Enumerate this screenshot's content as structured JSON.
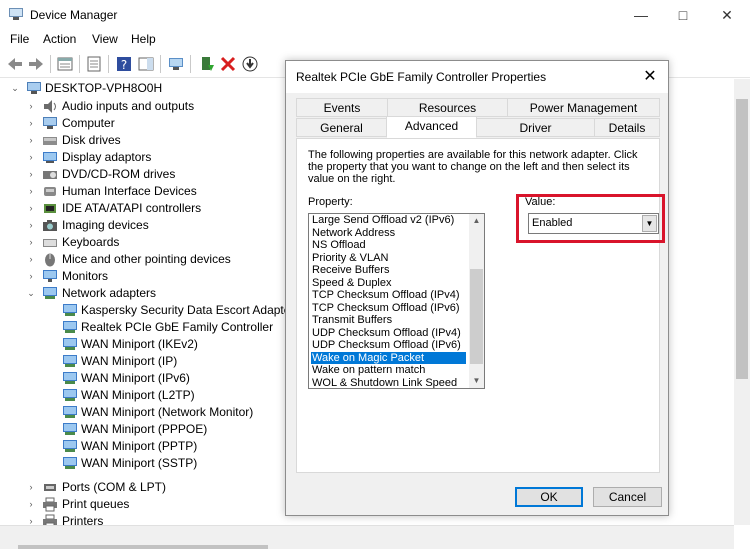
{
  "window": {
    "title": "Device Manager"
  },
  "menu": [
    {
      "label": "File"
    },
    {
      "label": "Action"
    },
    {
      "label": "View"
    },
    {
      "label": "Help"
    }
  ],
  "toolbar": {
    "buttons": [
      {
        "icon": "back-arrow-icon"
      },
      {
        "icon": "forward-arrow-icon"
      },
      {
        "icon": "properties-sheet-icon"
      },
      {
        "icon": "details-list-icon"
      },
      {
        "icon": "help-icon"
      },
      {
        "icon": "action-pane-icon"
      },
      {
        "icon": "scan-hardware-icon"
      },
      {
        "icon": "update-driver-icon"
      },
      {
        "icon": "uninstall-icon"
      },
      {
        "icon": "download-icon"
      }
    ]
  },
  "tree": {
    "root": "DESKTOP-VPH8O0H",
    "items": [
      {
        "label": "Audio inputs and outputs",
        "icon": "speaker-icon"
      },
      {
        "label": "Computer",
        "icon": "computer-icon"
      },
      {
        "label": "Disk drives",
        "icon": "disk-drive-icon"
      },
      {
        "label": "Display adaptors",
        "icon": "display-adapter-icon"
      },
      {
        "label": "DVD/CD-ROM drives",
        "icon": "dvd-drive-icon"
      },
      {
        "label": "Human Interface Devices",
        "icon": "hid-icon"
      },
      {
        "label": "IDE ATA/ATAPI controllers",
        "icon": "ide-controller-icon"
      },
      {
        "label": "Imaging devices",
        "icon": "camera-icon"
      },
      {
        "label": "Keyboards",
        "icon": "keyboard-icon"
      },
      {
        "label": "Mice and other pointing devices",
        "icon": "mouse-icon"
      },
      {
        "label": "Monitors",
        "icon": "monitor-icon"
      },
      {
        "label": "Network adapters",
        "icon": "network-adapter-icon",
        "expanded": true
      }
    ],
    "network_children": [
      {
        "label": "Kaspersky Security Data Escort Adapter"
      },
      {
        "label": "Realtek PCIe GbE Family Controller"
      },
      {
        "label": "WAN Miniport (IKEv2)"
      },
      {
        "label": "WAN Miniport (IP)"
      },
      {
        "label": "WAN Miniport (IPv6)"
      },
      {
        "label": "WAN Miniport (L2TP)"
      },
      {
        "label": "WAN Miniport (Network Monitor)"
      },
      {
        "label": "WAN Miniport (PPPOE)"
      },
      {
        "label": "WAN Miniport (PPTP)"
      },
      {
        "label": "WAN Miniport (SSTP)"
      }
    ],
    "after": [
      {
        "label": "Ports (COM & LPT)",
        "icon": "port-icon"
      },
      {
        "label": "Print queues",
        "icon": "printer-icon"
      },
      {
        "label": "Printers",
        "icon": "printer-icon"
      }
    ]
  },
  "dialog": {
    "title": "Realtek PCIe GbE Family Controller Properties",
    "close_label": "✕",
    "tabs_top": [
      {
        "label": "Events"
      },
      {
        "label": "Resources"
      },
      {
        "label": "Power Management"
      }
    ],
    "tabs_bottom": [
      {
        "label": "General"
      },
      {
        "label": "Advanced"
      },
      {
        "label": "Driver"
      },
      {
        "label": "Details"
      }
    ],
    "active_tab": "Advanced",
    "description": "The following properties are available for this network adapter. Click the property that you want to change on the left and then select its value on the right.",
    "property_label": "Property:",
    "value_label": "Value:",
    "properties": [
      "Large Send Offload v2 (IPv6)",
      "Network Address",
      "NS Offload",
      "Priority & VLAN",
      "Receive Buffers",
      "Speed & Duplex",
      "TCP Checksum Offload (IPv4)",
      "TCP Checksum Offload (IPv6)",
      "Transmit Buffers",
      "UDP Checksum Offload (IPv4)",
      "UDP Checksum Offload (IPv6)",
      "Wake on Magic Packet",
      "Wake on pattern match",
      "WOL & Shutdown Link Speed"
    ],
    "selected_property": "Wake on Magic Packet",
    "value": "Enabled",
    "ok_label": "OK",
    "cancel_label": "Cancel"
  },
  "colors": {
    "selection": "#0078d7",
    "highlight_box": "#d9142b"
  }
}
